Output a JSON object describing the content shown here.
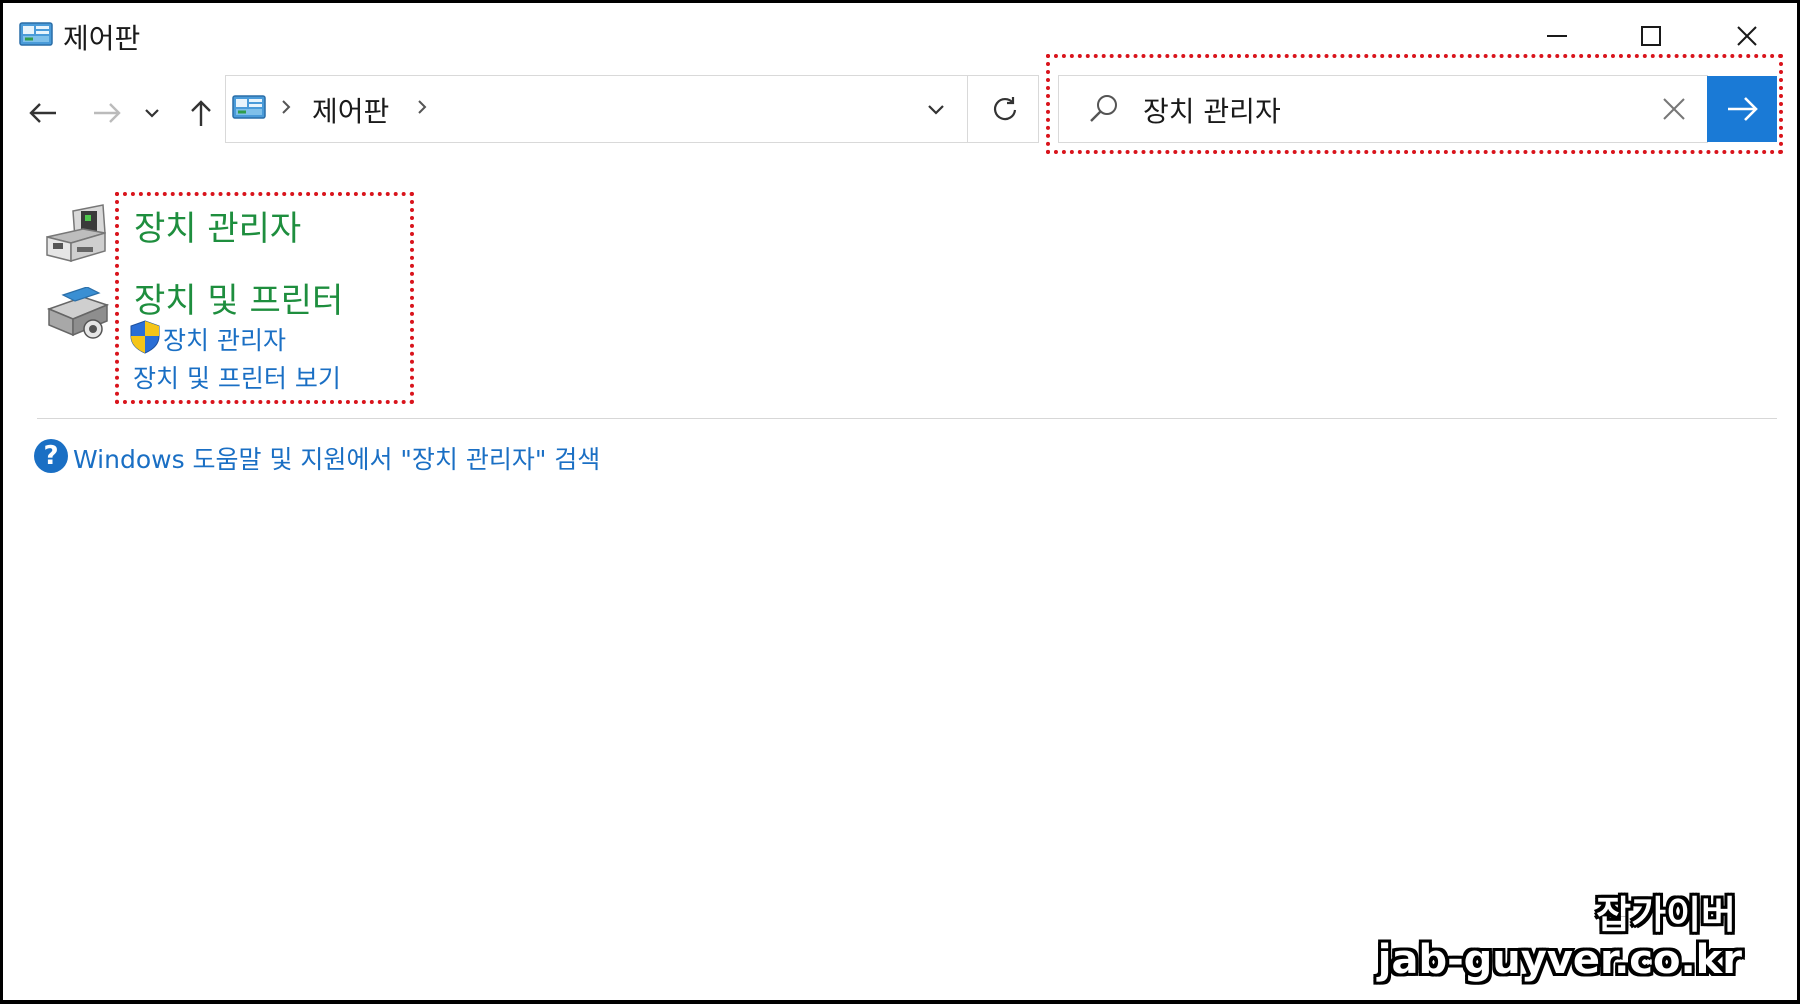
{
  "window": {
    "title": "제어판",
    "accent_color": "#1a7ad6",
    "controls": {
      "minimize": "minimize-icon",
      "maximize": "maximize-icon",
      "close": "close-icon"
    }
  },
  "nav": {
    "back": "arrow-left-icon",
    "forward": "arrow-right-icon",
    "recent": "chevron-down-icon",
    "up": "arrow-up-icon"
  },
  "address": {
    "crumbs": [
      "제어판"
    ],
    "icon": "control-panel-icon"
  },
  "search": {
    "value": "장치 관리자",
    "go_color": "#1a7ad6"
  },
  "results": [
    {
      "title": "장치 관리자",
      "icon": "device-manager-icon",
      "links": []
    },
    {
      "title": "장치 및 프린터",
      "icon": "devices-printers-icon",
      "links": [
        {
          "text": "장치 관리자",
          "icon": "uac-shield-icon"
        },
        {
          "text": "장치 및 프린터 보기"
        }
      ]
    }
  ],
  "help": {
    "text": "Windows 도움말 및 지원에서 \"장치 관리자\" 검색"
  },
  "colors": {
    "result_title": "#1e8e3e",
    "link": "#1a6fc4",
    "highlight_border": "#d9141c"
  },
  "watermark": {
    "line1": "잡가이버",
    "line2": "jab-guyver.co.kr"
  }
}
